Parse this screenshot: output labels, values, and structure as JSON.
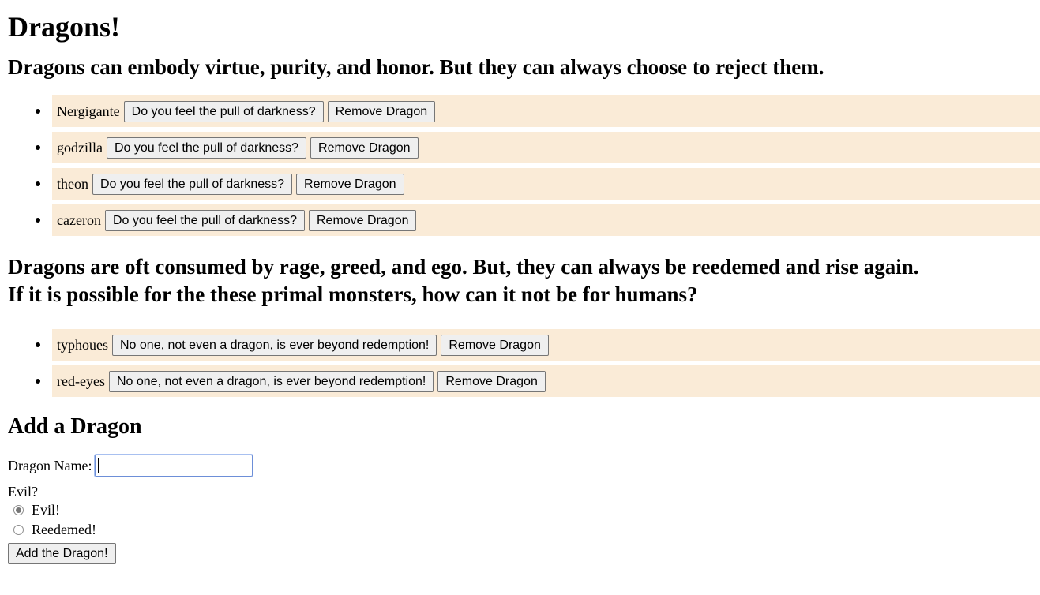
{
  "title": "Dragons!",
  "good_section": {
    "heading": "Dragons can embody virtue, purity, and honor. But they can always choose to reject them.",
    "items": [
      {
        "name": "Nergigante",
        "action_label": "Do you feel the pull of darkness?",
        "remove_label": "Remove Dragon"
      },
      {
        "name": "godzilla",
        "action_label": "Do you feel the pull of darkness?",
        "remove_label": "Remove Dragon"
      },
      {
        "name": "theon",
        "action_label": "Do you feel the pull of darkness?",
        "remove_label": "Remove Dragon"
      },
      {
        "name": "cazeron",
        "action_label": "Do you feel the pull of darkness?",
        "remove_label": "Remove Dragon"
      }
    ]
  },
  "evil_section": {
    "heading_line1": "Dragons are oft consumed by rage, greed, and ego. But, they can always be reedemed and rise again.",
    "heading_line2": "If it is possible for the these primal monsters, how can it not be for humans?",
    "items": [
      {
        "name": "typhoues",
        "action_label": "No one, not even a dragon, is ever beyond redemption!",
        "remove_label": "Remove Dragon"
      },
      {
        "name": "red-eyes",
        "action_label": "No one, not even a dragon, is ever beyond redemption!",
        "remove_label": "Remove Dragon"
      }
    ]
  },
  "form": {
    "heading": "Add a Dragon",
    "name_label": "Dragon Name:",
    "name_value": "",
    "evil_label": "Evil?",
    "options": [
      {
        "label": "Evil!",
        "checked": true
      },
      {
        "label": "Reedemed!",
        "checked": false
      }
    ],
    "submit_label": "Add the Dragon!"
  },
  "colors": {
    "list_item_bg": "#faebd7",
    "input_focus_border": "#6d8fd8"
  }
}
